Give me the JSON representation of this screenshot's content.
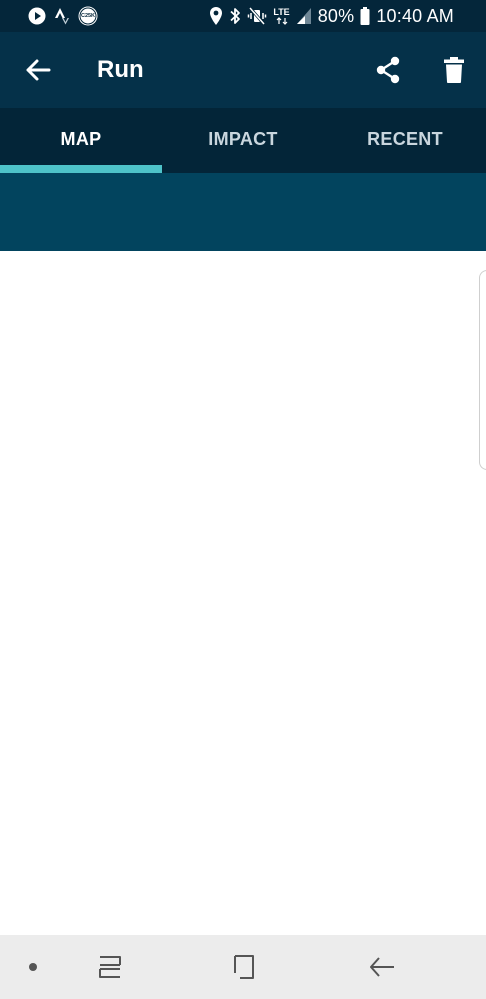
{
  "status_bar": {
    "battery": "80%",
    "time": "10:40 AM",
    "network": "LTE",
    "app_badge": "C25K",
    "icons": [
      "play-icon",
      "strava-icon",
      "c25k-icon",
      "location-icon",
      "bluetooth-icon",
      "vibrate-icon",
      "lte-icon",
      "signal-icon",
      "battery-icon"
    ]
  },
  "app_bar": {
    "title": "Run",
    "back_icon": "arrow-left-icon",
    "share_icon": "share-icon",
    "delete_icon": "trash-icon"
  },
  "tabs": [
    {
      "label": "MAP",
      "active": true
    },
    {
      "label": "IMPACT",
      "active": false
    },
    {
      "label": "RECENT",
      "active": false
    }
  ],
  "nav_bar": {
    "icons": [
      "dot-icon",
      "recents-icon",
      "home-icon",
      "back-icon"
    ]
  },
  "colors": {
    "status_bg": "#04263a",
    "appbar_bg": "#053149",
    "tabbar_bg": "#032538",
    "accent": "#4ec3c9",
    "banner_bg": "#02445e",
    "navbar_bg": "#ececec"
  }
}
